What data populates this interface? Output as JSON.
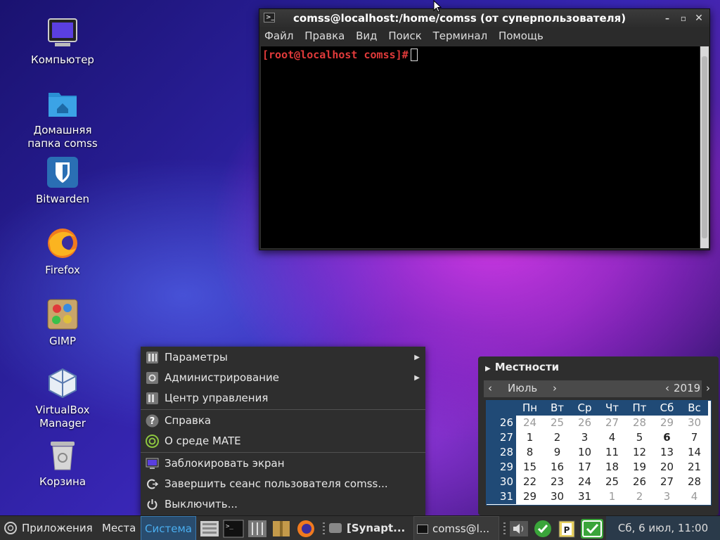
{
  "desktop": {
    "icons": [
      {
        "label": "Компьютер"
      },
      {
        "label": "Домашняя папка comss"
      },
      {
        "label": "Bitwarden"
      },
      {
        "label": "Firefox"
      },
      {
        "label": "GIMP"
      },
      {
        "label": "VirtualBox Manager"
      },
      {
        "label": "Корзина"
      }
    ]
  },
  "terminal": {
    "title": "comss@localhost:/home/comss (от суперпользователя)",
    "menu": [
      "Файл",
      "Правка",
      "Вид",
      "Поиск",
      "Терминал",
      "Помощь"
    ],
    "prompt": "[root@localhost comss]#"
  },
  "system_menu": {
    "items": [
      {
        "label": "Параметры",
        "icon": "preferences-icon",
        "submenu": true
      },
      {
        "label": "Администрирование",
        "icon": "administration-icon",
        "submenu": true
      },
      {
        "label": "Центр управления",
        "icon": "control-center-icon",
        "submenu": false
      },
      {
        "label": "Справка",
        "icon": "help-icon",
        "submenu": false
      },
      {
        "label": "О среде MATE",
        "icon": "mate-logo-icon",
        "submenu": false
      },
      {
        "label": "Заблокировать экран",
        "icon": "lock-screen-icon",
        "submenu": false
      },
      {
        "label": "Завершить сеанс пользователя comss...",
        "icon": "logout-icon",
        "submenu": false
      },
      {
        "label": "Выключить...",
        "icon": "power-icon",
        "submenu": false
      }
    ]
  },
  "calendar": {
    "header": "Местности",
    "month": "Июль",
    "year": "2019",
    "weekdays": [
      "Пн",
      "Вт",
      "Ср",
      "Чт",
      "Пт",
      "Сб",
      "Вс"
    ],
    "weeks": [
      {
        "num": "26",
        "days": [
          "24",
          "25",
          "26",
          "27",
          "28",
          "29",
          "30"
        ]
      },
      {
        "num": "27",
        "days": [
          "1",
          "2",
          "3",
          "4",
          "5",
          "6",
          "7"
        ]
      },
      {
        "num": "28",
        "days": [
          "8",
          "9",
          "10",
          "11",
          "12",
          "13",
          "14"
        ]
      },
      {
        "num": "29",
        "days": [
          "15",
          "16",
          "17",
          "18",
          "19",
          "20",
          "21"
        ]
      },
      {
        "num": "30",
        "days": [
          "22",
          "23",
          "24",
          "25",
          "26",
          "27",
          "28"
        ]
      },
      {
        "num": "31",
        "days": [
          "29",
          "30",
          "31",
          "1",
          "2",
          "3",
          "4"
        ]
      }
    ],
    "today": "6"
  },
  "taskbar": {
    "apps_label": "Приложения",
    "places_label": "Места",
    "system_label": "Система",
    "task1": "[Synapt...",
    "task2": "comss@l...",
    "clock": "Сб,  6 июл, 11:00"
  },
  "colors": {
    "accent": "#204a76",
    "prompt": "#e03a3a",
    "panel": "#303030"
  }
}
